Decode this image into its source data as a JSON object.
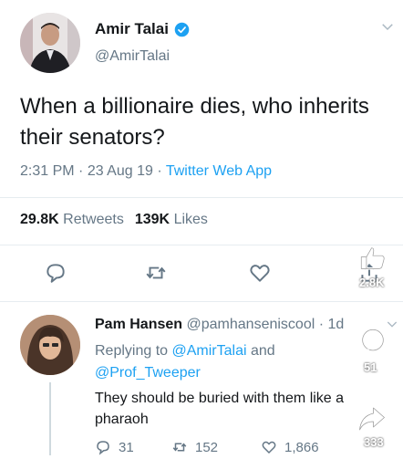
{
  "tweet": {
    "name": "Amir Talai",
    "handle": "@AmirTalai",
    "text": "When a billionaire dies, who inherits their senators?",
    "time": "2:31 PM",
    "date": "23 Aug 19",
    "separator": " · ",
    "app": "Twitter Web App",
    "retweets_value": "29.8K",
    "retweets_label": "Retweets",
    "likes_value": "139K",
    "likes_label": "Likes"
  },
  "overlay": {
    "likes_count": "2.8K",
    "comments_count": "51",
    "shares_count": "333"
  },
  "reply": {
    "name": "Pam Hansen",
    "handle": "@pamhanseniscool",
    "dot": " · ",
    "time": "1d",
    "replying_prefix": "Replying to ",
    "mention1": "@AmirTalai",
    "and": " and",
    "mention2": "@Prof_Tweeper",
    "text": "They should be buried with them like a pharaoh",
    "reply_count": "31",
    "retweet_count": "152",
    "like_count": "1,866"
  },
  "colors": {
    "link": "#1da1f2",
    "secondary": "#657786",
    "primary": "#14171a"
  }
}
